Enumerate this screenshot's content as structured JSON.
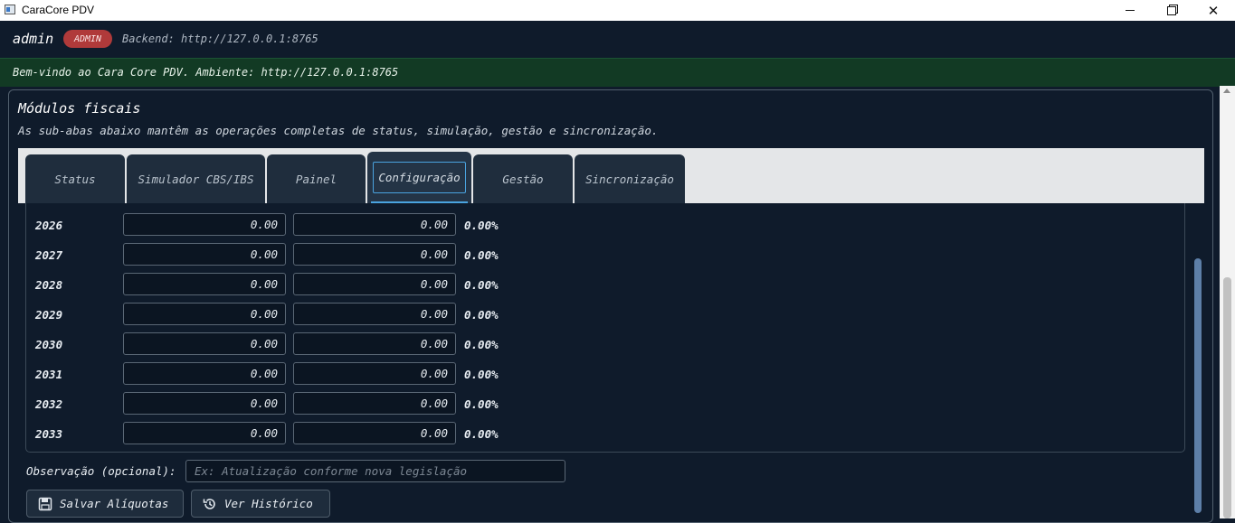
{
  "window": {
    "title": "CaraCore PDV"
  },
  "header": {
    "username": "admin",
    "role": "ADMIN",
    "backend": "Backend: http://127.0.0.1:8765"
  },
  "banner": {
    "message": "Bem-vindo ao Cara Core PDV. Ambiente: http://127.0.0.1:8765"
  },
  "section": {
    "title": "Módulos fiscais",
    "subtitle": "As sub-abas abaixo mantêm as operações completas de status, simulação, gestão e sincronização."
  },
  "tabs": [
    {
      "label": "Status",
      "active": false
    },
    {
      "label": "Simulador CBS/IBS",
      "active": false
    },
    {
      "label": "Painel",
      "active": false
    },
    {
      "label": "Configuração",
      "active": true
    },
    {
      "label": "Gestão",
      "active": false
    },
    {
      "label": "Sincronização",
      "active": false
    }
  ],
  "rates": [
    {
      "year": "2026",
      "cbs": "0.00",
      "ibs": "0.00",
      "total": "0.00%"
    },
    {
      "year": "2027",
      "cbs": "0.00",
      "ibs": "0.00",
      "total": "0.00%"
    },
    {
      "year": "2028",
      "cbs": "0.00",
      "ibs": "0.00",
      "total": "0.00%"
    },
    {
      "year": "2029",
      "cbs": "0.00",
      "ibs": "0.00",
      "total": "0.00%"
    },
    {
      "year": "2030",
      "cbs": "0.00",
      "ibs": "0.00",
      "total": "0.00%"
    },
    {
      "year": "2031",
      "cbs": "0.00",
      "ibs": "0.00",
      "total": "0.00%"
    },
    {
      "year": "2032",
      "cbs": "0.00",
      "ibs": "0.00",
      "total": "0.00%"
    },
    {
      "year": "2033",
      "cbs": "0.00",
      "ibs": "0.00",
      "total": "0.00%"
    }
  ],
  "observation": {
    "label": "Observação (opcional):",
    "placeholder": "Ex: Atualização conforme nova legislação"
  },
  "actions": {
    "save_label": "Salvar Alíquotas",
    "save_icon": "floppy-disk-icon",
    "history_label": "Ver Histórico",
    "history_icon": "history-icon"
  },
  "colors": {
    "background": "#0f1b2b",
    "banner": "#123a24",
    "badge": "#b03a3a",
    "accent": "#4aa3df"
  }
}
